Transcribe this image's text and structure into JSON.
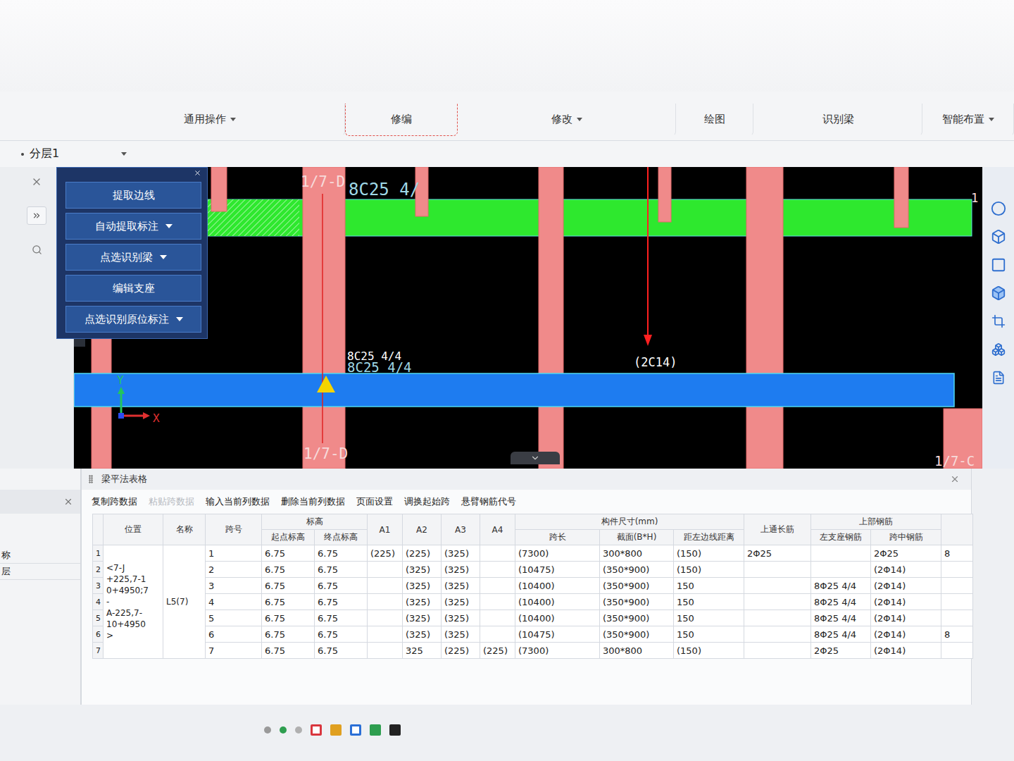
{
  "ribbon": {
    "groups": [
      {
        "label": "通用操作",
        "dropdown": true,
        "highlighted": false
      },
      {
        "label": "修编",
        "dropdown": false,
        "highlighted": true
      },
      {
        "label": "修改",
        "dropdown": true,
        "highlighted": false
      },
      {
        "label": "绘图",
        "dropdown": false,
        "highlighted": false
      },
      {
        "label": "识别梁",
        "dropdown": false,
        "highlighted": false
      },
      {
        "label": "智能布置",
        "dropdown": true,
        "highlighted": false
      }
    ]
  },
  "layer_select": {
    "value": "分层1"
  },
  "side_list": {
    "items": [
      "称",
      "层"
    ]
  },
  "float_panel": {
    "buttons": [
      {
        "label": "提取边线",
        "dropdown": false
      },
      {
        "label": "自动提取标注",
        "dropdown": true
      },
      {
        "label": "点选识别梁",
        "dropdown": true
      },
      {
        "label": "编辑支座",
        "dropdown": false
      },
      {
        "label": "点选识别原位标注",
        "dropdown": true
      }
    ]
  },
  "canvas": {
    "axis_labels": {
      "top": "1/7-D",
      "bottom": "1/7-D",
      "bottom_right": "1/7-C",
      "right_edge": "1"
    },
    "annotations": [
      {
        "text": "8C25 4/",
        "kind": "faint"
      },
      {
        "text": "8C25 4/4",
        "kind": "bright"
      },
      {
        "text": "8C25 4/4",
        "kind": "faint"
      },
      {
        "text": "(2C14)",
        "kind": "bright"
      }
    ],
    "axes": {
      "x": "X",
      "y": "Y"
    }
  },
  "table_panel": {
    "title": "梁平法表格",
    "toolbar": [
      {
        "label": "复制跨数据",
        "disabled": false
      },
      {
        "label": "粘贴跨数据",
        "disabled": true
      },
      {
        "label": "输入当前列数据",
        "disabled": false
      },
      {
        "label": "删除当前列数据",
        "disabled": false
      },
      {
        "label": "页面设置",
        "disabled": false
      },
      {
        "label": "调换起始跨",
        "disabled": false
      },
      {
        "label": "悬臂钢筋代号",
        "disabled": false
      }
    ],
    "columns": [
      {
        "label": "位置",
        "children": []
      },
      {
        "label": "名称",
        "children": []
      },
      {
        "label": "跨号",
        "children": []
      },
      {
        "label": "标高",
        "children": [
          "起点标高",
          "终点标高"
        ]
      },
      {
        "label": "A1",
        "children": []
      },
      {
        "label": "A2",
        "children": []
      },
      {
        "label": "A3",
        "children": []
      },
      {
        "label": "A4",
        "children": []
      },
      {
        "label": "构件尺寸(mm)",
        "children": [
          "跨长",
          "截面(B*H)",
          "距左边线距离"
        ]
      },
      {
        "label": "上通长筋",
        "children": []
      },
      {
        "label": "上部钢筋",
        "children": [
          "左支座钢筋",
          "跨中钢筋"
        ]
      },
      {
        "label": "",
        "children": []
      }
    ],
    "position_lines": [
      "<7-J",
      "+225,7-1",
      "0+4950;7",
      "-",
      "A-225,7-",
      "10+4950",
      ">"
    ],
    "name": "L5(7)",
    "rows": [
      {
        "index": "1",
        "cells": [
          "1",
          "6.75",
          "6.75",
          "(225)",
          "(225)",
          "(325)",
          "",
          "(7300)",
          "300*800",
          "(150)",
          "2Φ25",
          "",
          "2Φ25",
          "8"
        ]
      },
      {
        "index": "2",
        "cells": [
          "2",
          "6.75",
          "6.75",
          "",
          "(325)",
          "(325)",
          "",
          "(10475)",
          "(350*900)",
          "(150)",
          "",
          "",
          "(2Φ14)",
          ""
        ]
      },
      {
        "index": "3",
        "cells": [
          "3",
          "6.75",
          "6.75",
          "",
          "(325)",
          "(325)",
          "",
          "(10400)",
          "(350*900)",
          "150",
          "",
          "8Φ25 4/4",
          "(2Φ14)",
          ""
        ]
      },
      {
        "index": "4",
        "cells": [
          "4",
          "6.75",
          "6.75",
          "",
          "(325)",
          "(325)",
          "",
          "(10400)",
          "(350*900)",
          "150",
          "",
          "8Φ25 4/4",
          "(2Φ14)",
          ""
        ]
      },
      {
        "index": "5",
        "cells": [
          "5",
          "6.75",
          "6.75",
          "",
          "(325)",
          "(325)",
          "",
          "(10400)",
          "(350*900)",
          "150",
          "",
          "8Φ25 4/4",
          "(2Φ14)",
          ""
        ]
      },
      {
        "index": "6",
        "cells": [
          "6",
          "6.75",
          "6.75",
          "",
          "(325)",
          "(325)",
          "",
          "(10475)",
          "(350*900)",
          "150",
          "",
          "8Φ25 4/4",
          "(2Φ14)",
          "8"
        ]
      },
      {
        "index": "7",
        "cells": [
          "7",
          "6.75",
          "6.75",
          "",
          "325",
          "(225)",
          "(225)",
          "(7300)",
          "300*800",
          "(150)",
          "",
          "2Φ25",
          "(2Φ14)",
          ""
        ]
      }
    ]
  },
  "swatches": [
    {
      "kind": "dot",
      "color": "#9a9a9a"
    },
    {
      "kind": "dot",
      "color": "#2e9e4f"
    },
    {
      "kind": "dot",
      "color": "#b0b0b0"
    },
    {
      "kind": "outline",
      "color": "#d9363e"
    },
    {
      "kind": "fill",
      "color": "#e0a020"
    },
    {
      "kind": "outline",
      "color": "#2b6fd6"
    },
    {
      "kind": "fill",
      "color": "#2e9e4f"
    },
    {
      "kind": "fill",
      "color": "#222222"
    }
  ]
}
